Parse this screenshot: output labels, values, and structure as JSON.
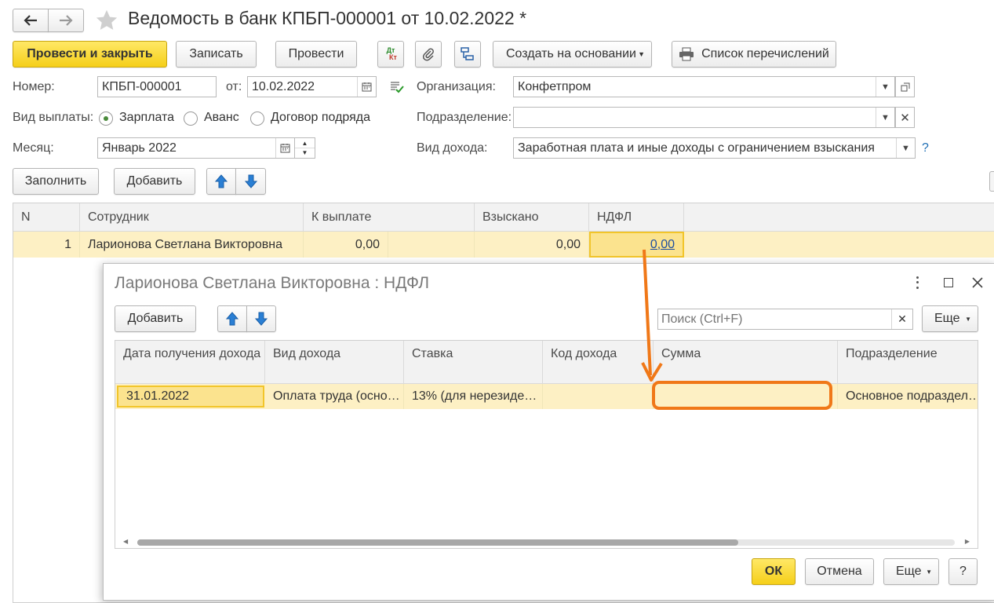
{
  "window": {
    "title": "Ведомость в банк КПБП-000001 от 10.02.2022 *"
  },
  "toolbar": {
    "post_close": "Провести и закрыть",
    "save": "Записать",
    "post": "Провести",
    "dtkt_top": "Дт",
    "dtkt_bottom": "Кт",
    "create_based": "Создать на основании",
    "transfer_list": "Список перечислений"
  },
  "form": {
    "number_label": "Номер:",
    "number_value": "КПБП-000001",
    "date_label": "от:",
    "date_value": "10.02.2022",
    "org_label": "Организация:",
    "org_value": "Конфетпром",
    "pay_type_label": "Вид выплаты:",
    "pay_options": [
      "Зарплата",
      "Аванс",
      "Договор подряда"
    ],
    "pay_selected": "Зарплата",
    "division_label": "Подразделение:",
    "division_value": "",
    "month_label": "Месяц:",
    "month_value": "Январь 2022",
    "income_type_label": "Вид дохода:",
    "income_type_value": "Заработная плата и иные доходы с ограничением взыскания",
    "help": "?"
  },
  "table_toolbar": {
    "fill": "Заполнить",
    "add": "Добавить"
  },
  "main_table": {
    "columns": [
      "N",
      "Сотрудник",
      "К выплате",
      "Взыскано",
      "НДФЛ"
    ],
    "rows": [
      {
        "n": "1",
        "employee": "Ларионова Светлана Викторовна",
        "to_pay": "0,00",
        "withheld": "0,00",
        "ndfl": "0,00"
      }
    ]
  },
  "dialog": {
    "title": "Ларионова Светлана Викторовна : НДФЛ",
    "add": "Добавить",
    "search_placeholder": "Поиск (Ctrl+F)",
    "more": "Еще",
    "columns": [
      "Дата получения дохода",
      "Вид дохода",
      "Ставка",
      "Код дохода",
      "Сумма",
      "Подразделение"
    ],
    "rows": [
      {
        "date": "31.01.2022",
        "income_type": "Оплата труда (осно…",
        "rate": "13% (для нерезиде…",
        "code": "",
        "sum": "",
        "division": "Основное подраздел…"
      }
    ],
    "ok": "ОК",
    "cancel": "Отмена",
    "more2": "Еще",
    "help": "?"
  },
  "colors": {
    "accent_yellow": "#f5cf19",
    "row_highlight": "#fdf0c4",
    "annotation": "#f07818",
    "link": "#1f4fa0"
  }
}
